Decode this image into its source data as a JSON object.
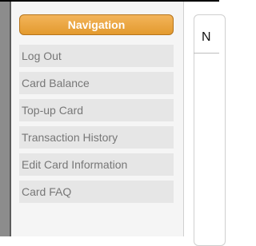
{
  "sidebar": {
    "header": "Navigation",
    "items": [
      {
        "label": "Log Out"
      },
      {
        "label": "Card Balance"
      },
      {
        "label": "Top-up Card"
      },
      {
        "label": "Transaction History"
      },
      {
        "label": "Edit Card Information"
      },
      {
        "label": "Card FAQ"
      }
    ]
  },
  "content": {
    "title": "N"
  },
  "colors": {
    "accent": "#e9a33f",
    "nav_item_bg": "#e6e6e6",
    "nav_text": "#777777",
    "left_strip": "#8c8c8c"
  }
}
